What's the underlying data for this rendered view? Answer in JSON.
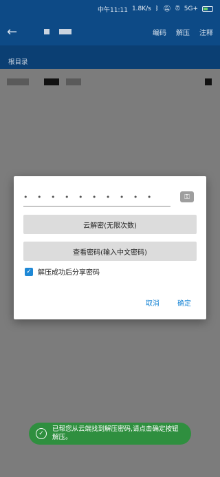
{
  "status_bar": {
    "time": "中午11:11",
    "network_speed": "1.8K/s",
    "bluetooth_icon": "bluetooth-icon",
    "mute_icon": "mute-icon",
    "alarm_icon": "alarm-icon",
    "network": "5G+",
    "battery_icon": "battery-icon"
  },
  "app_bar": {
    "back_icon": "back-arrow-icon",
    "actions": [
      "编码",
      "解压",
      "注释"
    ]
  },
  "breadcrumb": "根目录",
  "dialog": {
    "password_mask": "• • • • • • • • • •",
    "key_icon": "key-icon",
    "cloud_decrypt_label": "云解密(无限次数)",
    "view_password_label": "查看密码(输入中文密码)",
    "share_checkbox_checked": true,
    "share_checkbox_label": "解压成功后分享密码",
    "cancel_label": "取消",
    "confirm_label": "确定"
  },
  "toast": {
    "icon": "check-circle-icon",
    "message": "已帮您从云端找到解压密码,请点击确定按钮解压。"
  },
  "colors": {
    "app_bar": "#0d4a86",
    "accent": "#1e88d6",
    "toast": "#2f8f3f"
  }
}
